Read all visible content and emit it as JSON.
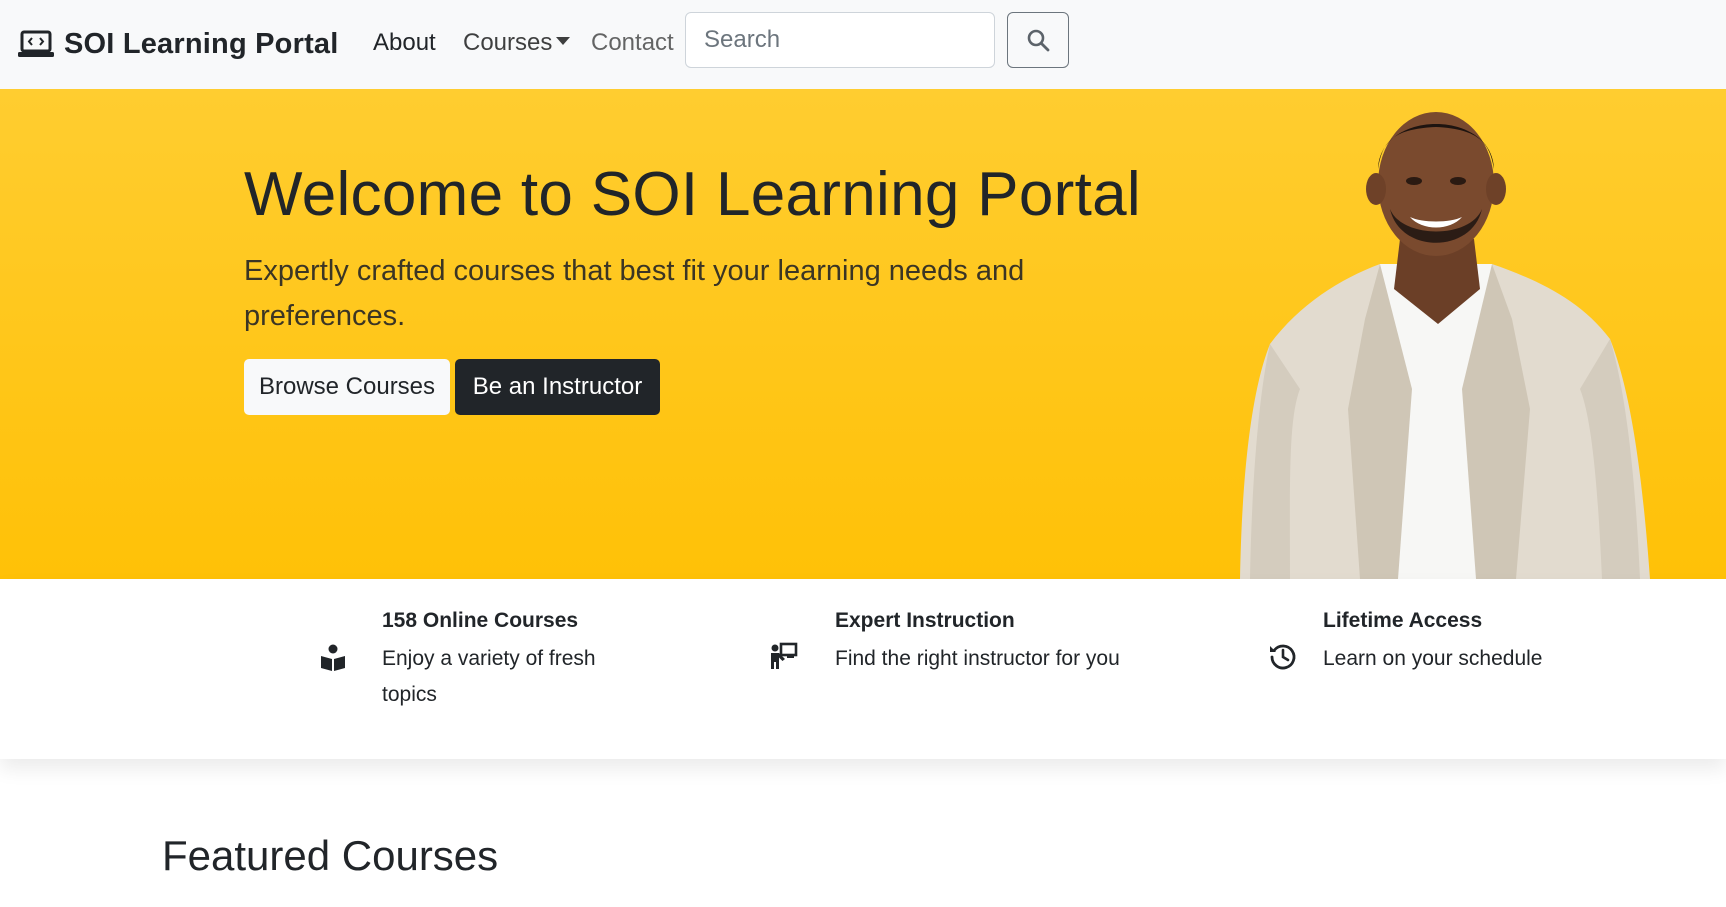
{
  "navbar": {
    "brand_label": "SOI Learning Portal",
    "brand_icon": "laptop-code-icon",
    "links": {
      "about": "About",
      "courses": "Courses",
      "contact": "Contact"
    },
    "search": {
      "placeholder": "Search",
      "value": "",
      "button_icon": "search-icon"
    }
  },
  "hero": {
    "title": "Welcome to SOI Learning Portal",
    "lead": "Expertly crafted courses that best fit your learning needs and preferences.",
    "primary_button": "Browse Courses",
    "secondary_button": "Be an Instructor",
    "background_color": "#ffc107"
  },
  "features": [
    {
      "icon": "book-reader-icon",
      "title": "158 Online Courses",
      "text": "Enjoy a variety of fresh topics"
    },
    {
      "icon": "chalkboard-teacher-icon",
      "title": "Expert Instruction",
      "text": "Find the right instructor for you"
    },
    {
      "icon": "history-clock-icon",
      "title": "Lifetime Access",
      "text": "Learn on your schedule"
    }
  ],
  "featured": {
    "heading": "Featured Courses"
  }
}
